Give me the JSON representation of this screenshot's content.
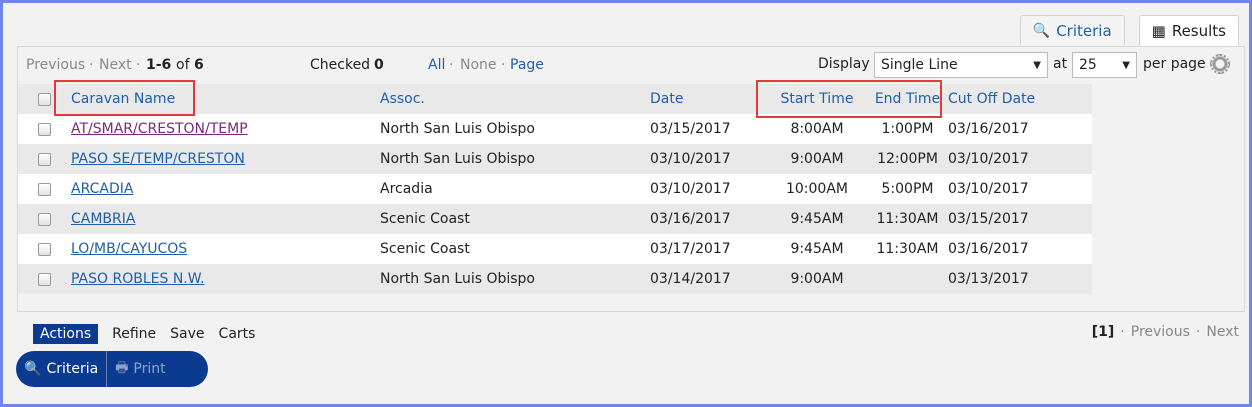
{
  "tabs": {
    "criteria": "Criteria",
    "results": "Results"
  },
  "pagination": {
    "previous": "Previous",
    "sep": "·",
    "next": "Next",
    "range": "1-6",
    "of": "of",
    "total": "6"
  },
  "checked": {
    "label": "Checked",
    "count": "0"
  },
  "select_links": {
    "all": "All",
    "none": "None",
    "page": "Page",
    "sep": "·"
  },
  "display": {
    "label": "Display",
    "value": "Single Line",
    "at": "at",
    "per_page_value": "25",
    "per_page": "per page"
  },
  "columns": [
    "Caravan Name",
    "Assoc.",
    "Date",
    "Start Time",
    "End Time",
    "Cut Off Date"
  ],
  "rows": [
    {
      "name": "AT/SMAR/CRESTON/TEMP",
      "assoc": "North San Luis Obispo",
      "date": "03/15/2017",
      "start": "8:00AM",
      "end": "1:00PM",
      "cutoff": "03/16/2017"
    },
    {
      "name": "PASO SE/TEMP/CRESTON",
      "assoc": "North San Luis Obispo",
      "date": "03/10/2017",
      "start": "9:00AM",
      "end": "12:00PM",
      "cutoff": "03/10/2017"
    },
    {
      "name": "ARCADIA",
      "assoc": "Arcadia",
      "date": "03/10/2017",
      "start": "10:00AM",
      "end": "5:00PM",
      "cutoff": "03/10/2017"
    },
    {
      "name": "CAMBRIA",
      "assoc": "Scenic Coast",
      "date": "03/16/2017",
      "start": "9:45AM",
      "end": "11:30AM",
      "cutoff": "03/15/2017"
    },
    {
      "name": "LO/MB/CAYUCOS",
      "assoc": "Scenic Coast",
      "date": "03/17/2017",
      "start": "9:45AM",
      "end": "11:30AM",
      "cutoff": "03/16/2017"
    },
    {
      "name": "PASO ROBLES N.W.",
      "assoc": "North San Luis Obispo",
      "date": "03/14/2017",
      "start": "9:00AM",
      "end": "",
      "cutoff": "03/13/2017"
    }
  ],
  "bottom_menu": {
    "actions": "Actions",
    "refine": "Refine",
    "save": "Save",
    "carts": "Carts"
  },
  "bottom_pager": {
    "current": "[1]",
    "previous": "Previous",
    "next": "Next",
    "sep": "·"
  },
  "buttons": {
    "criteria": "Criteria",
    "print": "Print"
  },
  "colors": {
    "link": "#1f5fa8",
    "highlight": "#e03b3b",
    "accent": "#0b3a91"
  }
}
